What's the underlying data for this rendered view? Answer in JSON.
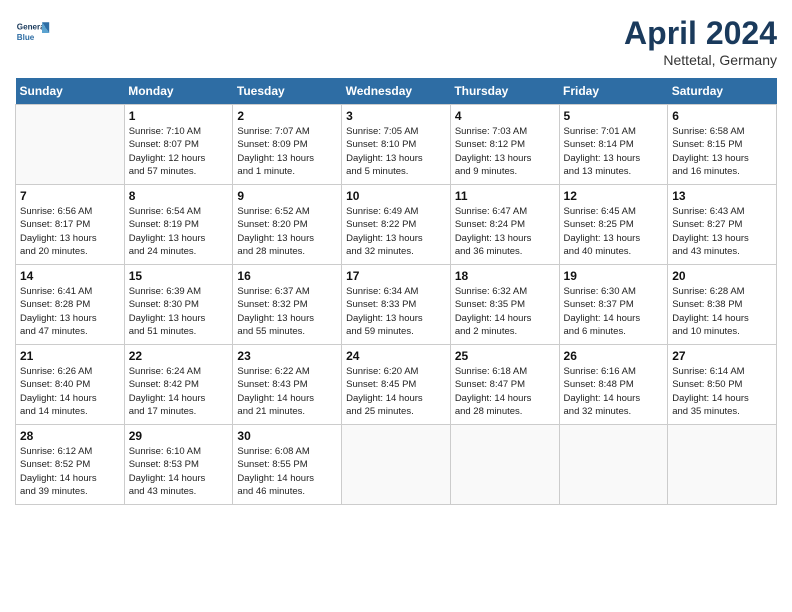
{
  "header": {
    "month_title": "April 2024",
    "location": "Nettetal, Germany",
    "logo_line1": "General",
    "logo_line2": "Blue"
  },
  "days_of_week": [
    "Sunday",
    "Monday",
    "Tuesday",
    "Wednesday",
    "Thursday",
    "Friday",
    "Saturday"
  ],
  "weeks": [
    [
      {
        "day": "",
        "info": ""
      },
      {
        "day": "1",
        "info": "Sunrise: 7:10 AM\nSunset: 8:07 PM\nDaylight: 12 hours\nand 57 minutes."
      },
      {
        "day": "2",
        "info": "Sunrise: 7:07 AM\nSunset: 8:09 PM\nDaylight: 13 hours\nand 1 minute."
      },
      {
        "day": "3",
        "info": "Sunrise: 7:05 AM\nSunset: 8:10 PM\nDaylight: 13 hours\nand 5 minutes."
      },
      {
        "day": "4",
        "info": "Sunrise: 7:03 AM\nSunset: 8:12 PM\nDaylight: 13 hours\nand 9 minutes."
      },
      {
        "day": "5",
        "info": "Sunrise: 7:01 AM\nSunset: 8:14 PM\nDaylight: 13 hours\nand 13 minutes."
      },
      {
        "day": "6",
        "info": "Sunrise: 6:58 AM\nSunset: 8:15 PM\nDaylight: 13 hours\nand 16 minutes."
      }
    ],
    [
      {
        "day": "7",
        "info": "Sunrise: 6:56 AM\nSunset: 8:17 PM\nDaylight: 13 hours\nand 20 minutes."
      },
      {
        "day": "8",
        "info": "Sunrise: 6:54 AM\nSunset: 8:19 PM\nDaylight: 13 hours\nand 24 minutes."
      },
      {
        "day": "9",
        "info": "Sunrise: 6:52 AM\nSunset: 8:20 PM\nDaylight: 13 hours\nand 28 minutes."
      },
      {
        "day": "10",
        "info": "Sunrise: 6:49 AM\nSunset: 8:22 PM\nDaylight: 13 hours\nand 32 minutes."
      },
      {
        "day": "11",
        "info": "Sunrise: 6:47 AM\nSunset: 8:24 PM\nDaylight: 13 hours\nand 36 minutes."
      },
      {
        "day": "12",
        "info": "Sunrise: 6:45 AM\nSunset: 8:25 PM\nDaylight: 13 hours\nand 40 minutes."
      },
      {
        "day": "13",
        "info": "Sunrise: 6:43 AM\nSunset: 8:27 PM\nDaylight: 13 hours\nand 43 minutes."
      }
    ],
    [
      {
        "day": "14",
        "info": "Sunrise: 6:41 AM\nSunset: 8:28 PM\nDaylight: 13 hours\nand 47 minutes."
      },
      {
        "day": "15",
        "info": "Sunrise: 6:39 AM\nSunset: 8:30 PM\nDaylight: 13 hours\nand 51 minutes."
      },
      {
        "day": "16",
        "info": "Sunrise: 6:37 AM\nSunset: 8:32 PM\nDaylight: 13 hours\nand 55 minutes."
      },
      {
        "day": "17",
        "info": "Sunrise: 6:34 AM\nSunset: 8:33 PM\nDaylight: 13 hours\nand 59 minutes."
      },
      {
        "day": "18",
        "info": "Sunrise: 6:32 AM\nSunset: 8:35 PM\nDaylight: 14 hours\nand 2 minutes."
      },
      {
        "day": "19",
        "info": "Sunrise: 6:30 AM\nSunset: 8:37 PM\nDaylight: 14 hours\nand 6 minutes."
      },
      {
        "day": "20",
        "info": "Sunrise: 6:28 AM\nSunset: 8:38 PM\nDaylight: 14 hours\nand 10 minutes."
      }
    ],
    [
      {
        "day": "21",
        "info": "Sunrise: 6:26 AM\nSunset: 8:40 PM\nDaylight: 14 hours\nand 14 minutes."
      },
      {
        "day": "22",
        "info": "Sunrise: 6:24 AM\nSunset: 8:42 PM\nDaylight: 14 hours\nand 17 minutes."
      },
      {
        "day": "23",
        "info": "Sunrise: 6:22 AM\nSunset: 8:43 PM\nDaylight: 14 hours\nand 21 minutes."
      },
      {
        "day": "24",
        "info": "Sunrise: 6:20 AM\nSunset: 8:45 PM\nDaylight: 14 hours\nand 25 minutes."
      },
      {
        "day": "25",
        "info": "Sunrise: 6:18 AM\nSunset: 8:47 PM\nDaylight: 14 hours\nand 28 minutes."
      },
      {
        "day": "26",
        "info": "Sunrise: 6:16 AM\nSunset: 8:48 PM\nDaylight: 14 hours\nand 32 minutes."
      },
      {
        "day": "27",
        "info": "Sunrise: 6:14 AM\nSunset: 8:50 PM\nDaylight: 14 hours\nand 35 minutes."
      }
    ],
    [
      {
        "day": "28",
        "info": "Sunrise: 6:12 AM\nSunset: 8:52 PM\nDaylight: 14 hours\nand 39 minutes."
      },
      {
        "day": "29",
        "info": "Sunrise: 6:10 AM\nSunset: 8:53 PM\nDaylight: 14 hours\nand 43 minutes."
      },
      {
        "day": "30",
        "info": "Sunrise: 6:08 AM\nSunset: 8:55 PM\nDaylight: 14 hours\nand 46 minutes."
      },
      {
        "day": "",
        "info": ""
      },
      {
        "day": "",
        "info": ""
      },
      {
        "day": "",
        "info": ""
      },
      {
        "day": "",
        "info": ""
      }
    ]
  ]
}
